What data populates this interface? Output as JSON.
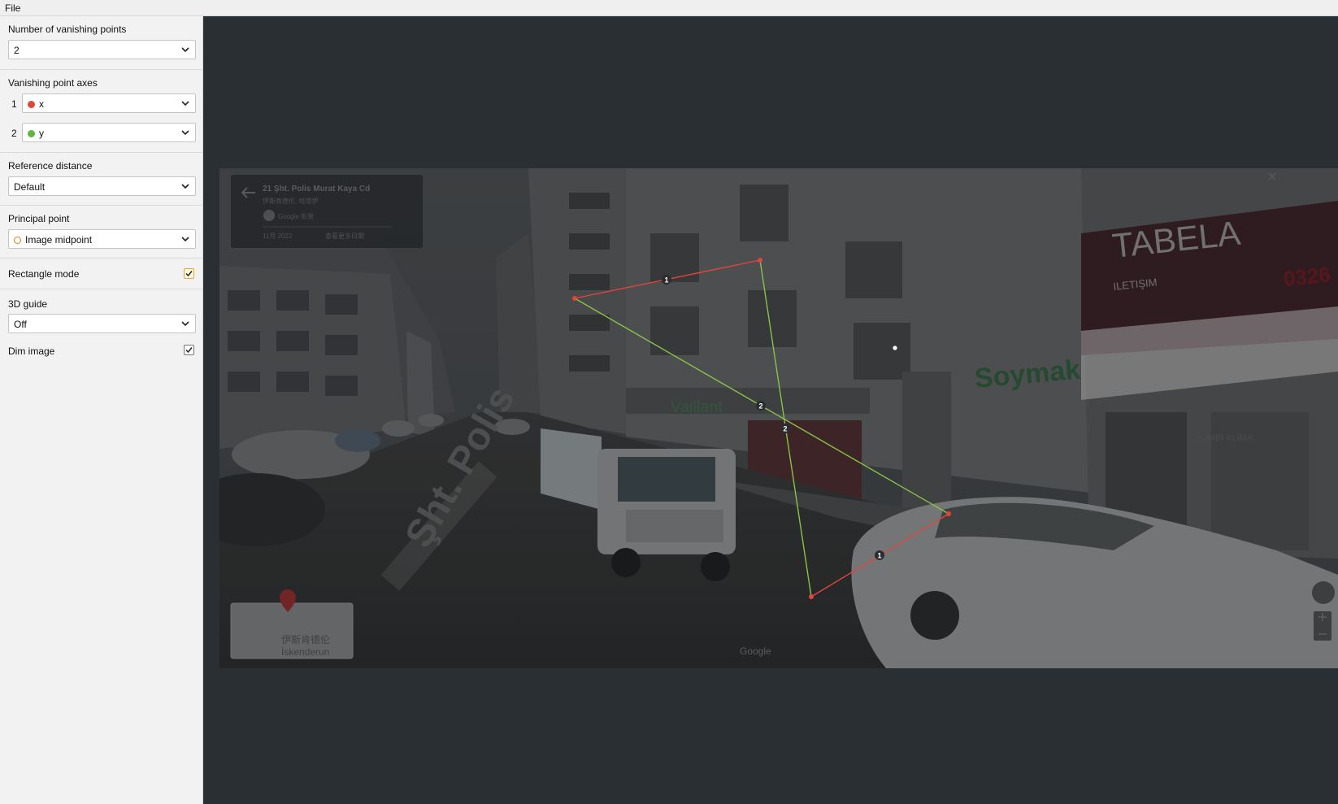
{
  "menu": {
    "file_label": "File"
  },
  "sidebar": {
    "vp_count": {
      "label": "Number of vanishing points",
      "value": "2"
    },
    "vp_axes": {
      "label": "Vanishing point axes",
      "items": [
        {
          "index": "1",
          "value": "x",
          "color": "#e0463c"
        },
        {
          "index": "2",
          "value": "y",
          "color": "#5fb83a"
        }
      ]
    },
    "reference_distance": {
      "label": "Reference distance",
      "value": "Default"
    },
    "principal_point": {
      "label": "Principal point",
      "value": "Image midpoint",
      "color": "#e07b18"
    },
    "rectangle_mode": {
      "label": "Rectangle mode",
      "checked": true
    },
    "guide_3d": {
      "label": "3D guide",
      "value": "Off"
    },
    "dim_image": {
      "label": "Dim image",
      "checked": true
    }
  },
  "image": {
    "streetview_card": {
      "title": "21 Şht. Polis Murat Kaya Cd",
      "subtitle": "伊斯肯德伦, 哈塔伊",
      "source": "Google 街景",
      "date": "11月 2022",
      "more_dates": "查看更多日期"
    },
    "sign_tabela": "TABELA",
    "sign_tabela_sub": "ILETIŞIM",
    "sign_phone": "0326",
    "sign_vaillant": "Vaillant",
    "sign_soymak": "Soymak",
    "sign_kombi": "KOMBİ KLİMA",
    "road_text": "Şht. Polis",
    "minimap_city_cn": "伊斯肯德伦",
    "minimap_city": "İskenderun",
    "google_mark": "Google"
  },
  "control_points": {
    "line_labels": {
      "x1": "1",
      "x2": "1",
      "y1": "2",
      "y2": "2"
    },
    "colors": {
      "x": "#e0463c",
      "y": "#8ac24a"
    }
  }
}
